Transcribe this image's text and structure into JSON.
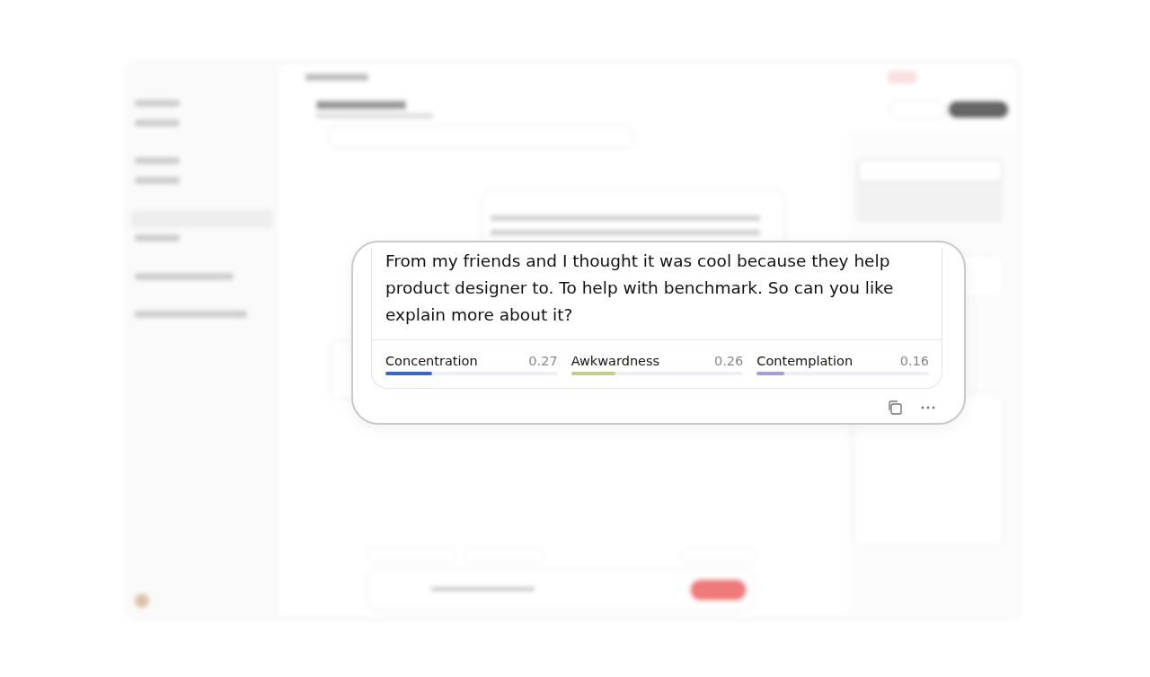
{
  "message": {
    "lines": [
      "From my friends and I thought it was cool because they help",
      "product designer to. To help with benchmark. So can you like",
      "explain more about it?"
    ]
  },
  "emotions": [
    {
      "name": "Concentration",
      "score": "0.27",
      "level": 0.27,
      "color": "#3b63d8"
    },
    {
      "name": "Awkwardness",
      "score": "0.26",
      "level": 0.26,
      "color": "#c4cc8a"
    },
    {
      "name": "Contemplation",
      "score": "0.16",
      "level": 0.16,
      "color": "#a89cdc"
    }
  ]
}
